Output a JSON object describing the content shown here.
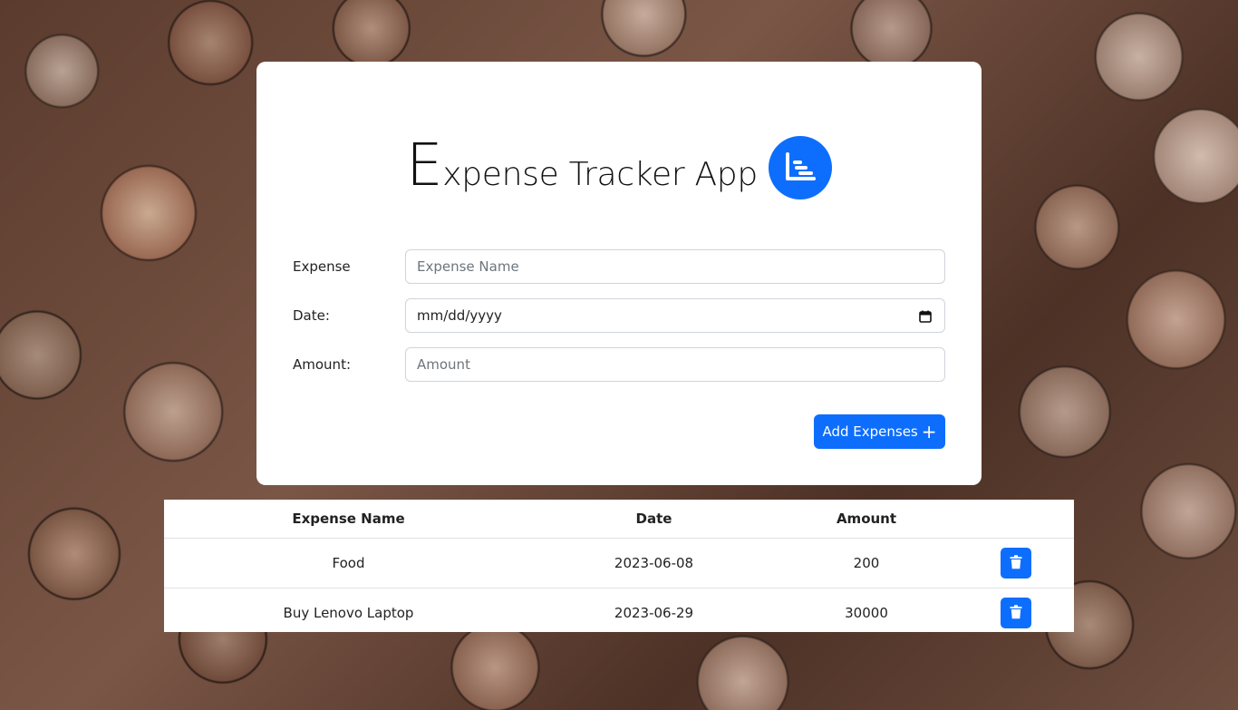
{
  "app": {
    "title_first_letter": "E",
    "title_rest": "xpense Tracker App",
    "logo_icon": "chart-gantt-icon",
    "accent_color": "#0d6efd"
  },
  "form": {
    "expense_label": "Expense",
    "expense_placeholder": "Expense Name",
    "expense_value": "",
    "date_label": "Date:",
    "date_display": "mm/dd/yyyy",
    "date_icon": "calendar-icon",
    "amount_label": "Amount:",
    "amount_placeholder": "Amount",
    "amount_value": "",
    "add_button_label": "Add Expenses",
    "add_button_icon": "plus-icon"
  },
  "table": {
    "headers": [
      "Expense Name",
      "Date",
      "Amount",
      ""
    ],
    "rows": [
      {
        "name": "Food",
        "date": "2023-06-08",
        "amount": "200",
        "action_icon": "trash-icon"
      },
      {
        "name": "Buy Lenovo Laptop",
        "date": "2023-06-29",
        "amount": "30000",
        "action_icon": "trash-icon"
      }
    ]
  }
}
